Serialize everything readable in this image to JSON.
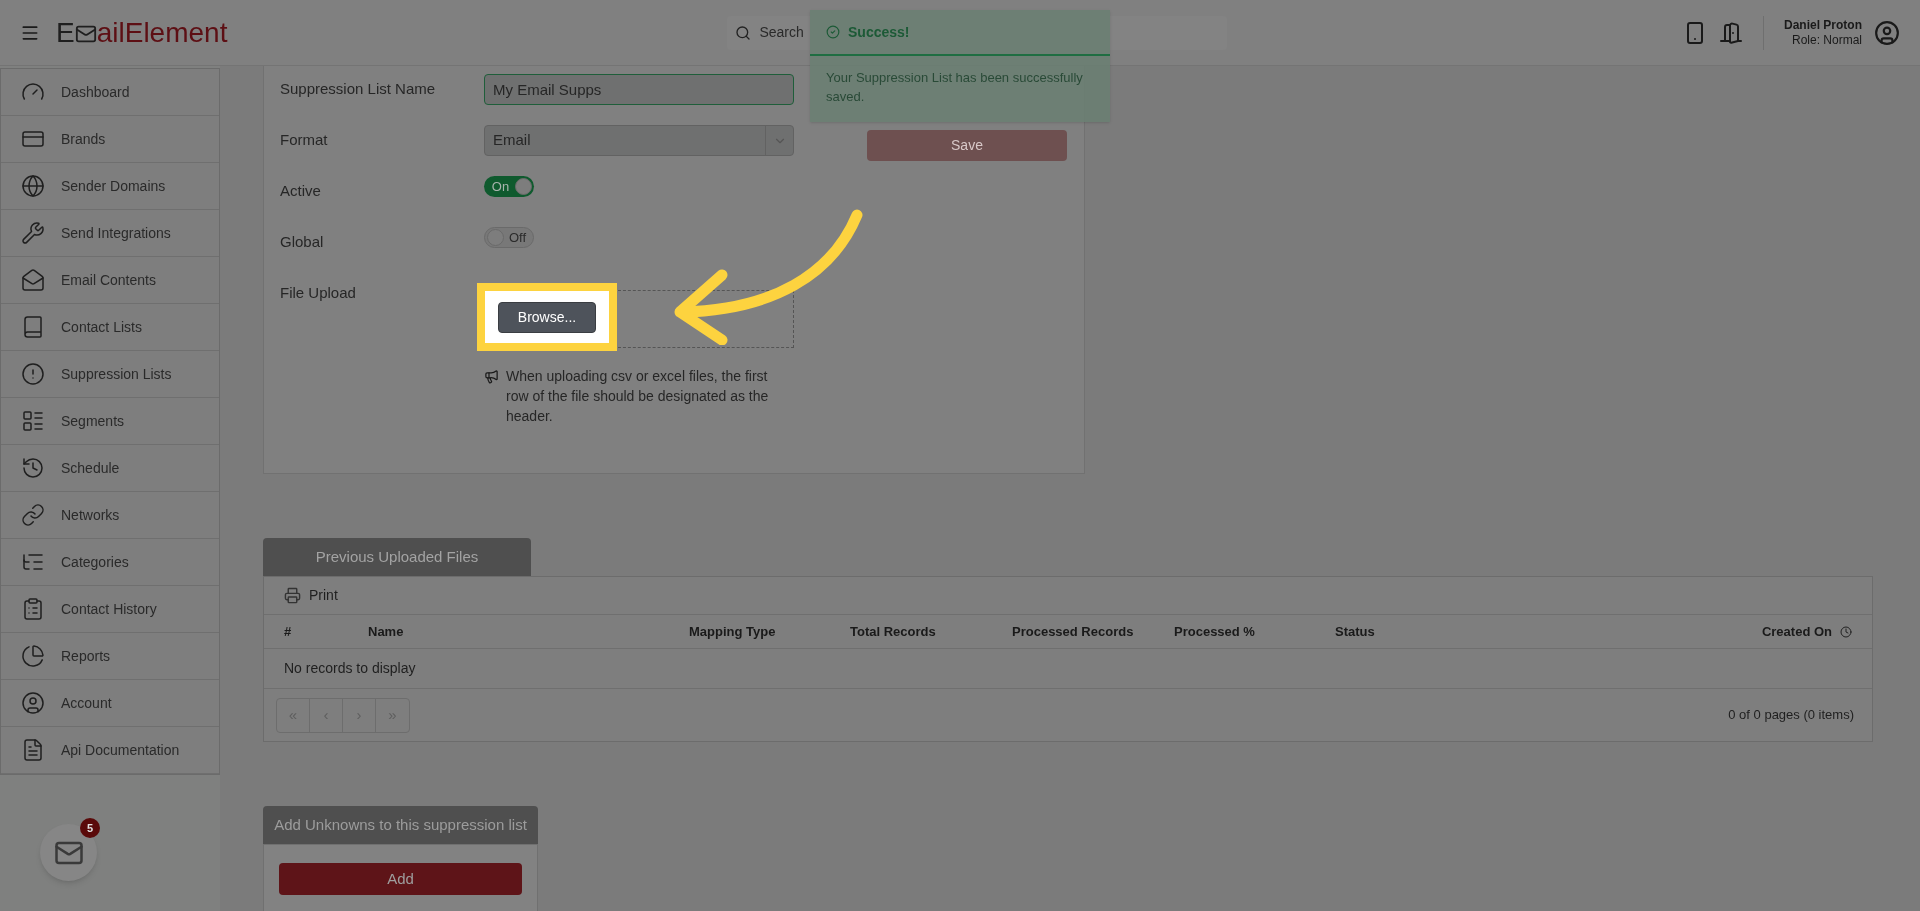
{
  "header": {
    "logo": {
      "prefix": "E",
      "suffix": "ailElement"
    },
    "search": {
      "placeholder": "Search"
    },
    "user": {
      "name": "Daniel Proton",
      "role": "Role: Normal"
    }
  },
  "toast": {
    "title": "Success!",
    "message": "Your Suppression List has been successfully saved."
  },
  "sidebar": {
    "items": [
      {
        "label": "Dashboard"
      },
      {
        "label": "Brands"
      },
      {
        "label": "Sender Domains"
      },
      {
        "label": "Send Integrations"
      },
      {
        "label": "Email Contents"
      },
      {
        "label": "Contact Lists"
      },
      {
        "label": "Suppression Lists"
      },
      {
        "label": "Segments"
      },
      {
        "label": "Schedule"
      },
      {
        "label": "Networks"
      },
      {
        "label": "Categories"
      },
      {
        "label": "Contact History"
      },
      {
        "label": "Reports"
      },
      {
        "label": "Account"
      },
      {
        "label": "Api Documentation"
      }
    ],
    "badge": "5"
  },
  "form": {
    "fields": [
      {
        "kind": "text",
        "label": "Suppression List Name",
        "value": "My Email Supps"
      },
      {
        "kind": "select",
        "label": "Format",
        "value": "Email"
      },
      {
        "kind": "toggle",
        "label": "Active",
        "on": true,
        "text": "On"
      },
      {
        "kind": "toggle",
        "label": "Global",
        "on": false,
        "text": "Off"
      },
      {
        "kind": "upload",
        "label": "File Upload",
        "button": "Browse...",
        "note": "When uploading csv or excel files, the first row of the file should be designated as the header."
      }
    ],
    "save_button": "Save"
  },
  "files_panel": {
    "tab": "Previous Uploaded Files",
    "print": "Print",
    "columns": [
      "#",
      "Name",
      "Mapping Type",
      "Total Records",
      "Processed Records",
      "Processed %",
      "Status",
      "Created On"
    ],
    "empty": "No records to display",
    "pager": [
      "«",
      "‹",
      "›",
      "»"
    ],
    "page_info": "0 of 0 pages (0 items)"
  },
  "unknowns_panel": {
    "title": "Add Unknowns to this suppression list",
    "button": "Add"
  }
}
